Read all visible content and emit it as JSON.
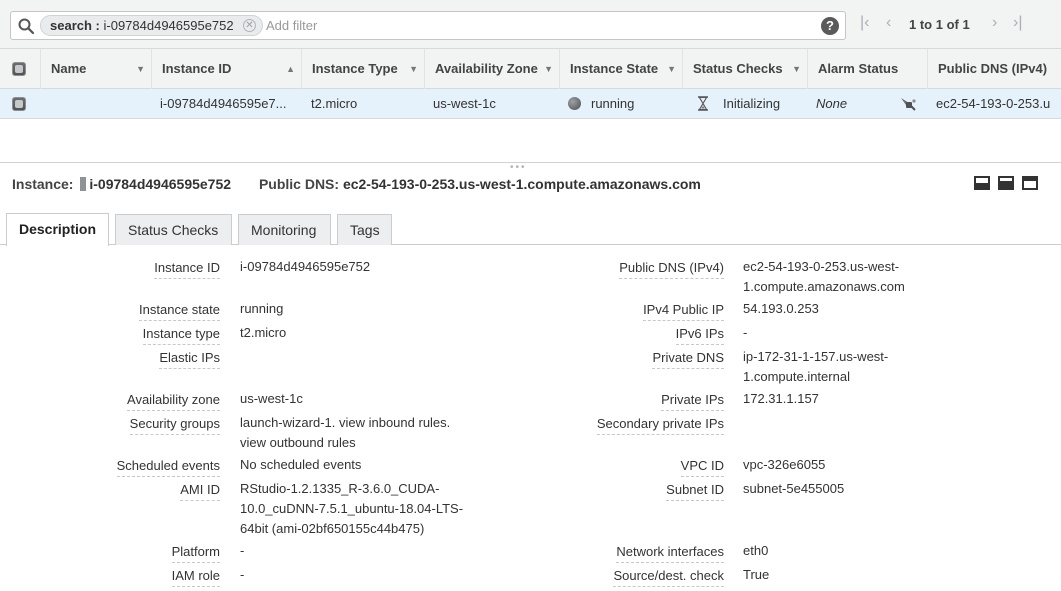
{
  "filter": {
    "chip_key": "search :",
    "chip_value": "i-09784d4946595e752",
    "placeholder": "Add filter",
    "help": "?"
  },
  "pager": {
    "first": "|<",
    "prev": "<",
    "count": "1 to 1 of 1",
    "next": ">",
    "last": ">|"
  },
  "table": {
    "headers": [
      "Name",
      "Instance ID",
      "Instance Type",
      "Availability Zone",
      "Instance State",
      "Status Checks",
      "Alarm Status",
      "Public DNS (IPv4)"
    ],
    "row": {
      "instance_id": "i-09784d4946595e7...",
      "instance_type": "t2.micro",
      "availability_zone": "us-west-1c",
      "instance_state": "running",
      "status_checks": "Initializing",
      "alarm_status": "None",
      "public_dns": "ec2-54-193-0-253.u"
    }
  },
  "detail": {
    "instance_label": "Instance:",
    "instance_id": "i-09784d4946595e752",
    "dns_label": "Public DNS:",
    "dns_value": "ec2-54-193-0-253.us-west-1.compute.amazonaws.com"
  },
  "tabs": [
    "Description",
    "Status Checks",
    "Monitoring",
    "Tags"
  ],
  "description": {
    "left": [
      {
        "label": "Instance ID",
        "value": [
          "i-09784d4946595e752"
        ]
      },
      {
        "label": "Instance state",
        "value": [
          "running"
        ]
      },
      {
        "label": "Instance type",
        "value": [
          "t2.micro"
        ]
      },
      {
        "label": "Elastic IPs",
        "value": [
          ""
        ]
      },
      {
        "label": "Availability zone",
        "value": [
          "us-west-1c"
        ]
      },
      {
        "label": "Security groups",
        "value": [
          "launch-wizard-1. view inbound rules.",
          "view outbound rules"
        ]
      },
      {
        "label": "Scheduled events",
        "value": [
          "No scheduled events"
        ]
      },
      {
        "label": "AMI ID",
        "value": [
          "RStudio-1.2.1335_R-3.6.0_CUDA-",
          "10.0_cuDNN-7.5.1_ubuntu-18.04-LTS-",
          "64bit (ami-02bf650155c44b475)"
        ]
      },
      {
        "label": "Platform",
        "value": [
          "-"
        ]
      },
      {
        "label": "IAM role",
        "value": [
          "-"
        ]
      }
    ],
    "right": [
      {
        "label": "Public DNS (IPv4)",
        "value": [
          "ec2-54-193-0-253.us-west-",
          "1.compute.amazonaws.com"
        ]
      },
      {
        "label": "IPv4 Public IP",
        "value": [
          "54.193.0.253"
        ]
      },
      {
        "label": "IPv6 IPs",
        "value": [
          "-"
        ]
      },
      {
        "label": "Private DNS",
        "value": [
          "ip-172-31-1-157.us-west-",
          "1.compute.internal"
        ]
      },
      {
        "label": "Private IPs",
        "value": [
          "172.31.1.157"
        ]
      },
      {
        "label": "Secondary private IPs",
        "value": [
          ""
        ]
      },
      {
        "label": "VPC ID",
        "value": [
          "vpc-326e6055"
        ]
      },
      {
        "label": "Subnet ID",
        "value": [
          "subnet-5e455005"
        ]
      },
      {
        "label": "Network interfaces",
        "value": [
          "eth0"
        ]
      },
      {
        "label": "Source/dest. check",
        "value": [
          "True"
        ]
      }
    ]
  }
}
